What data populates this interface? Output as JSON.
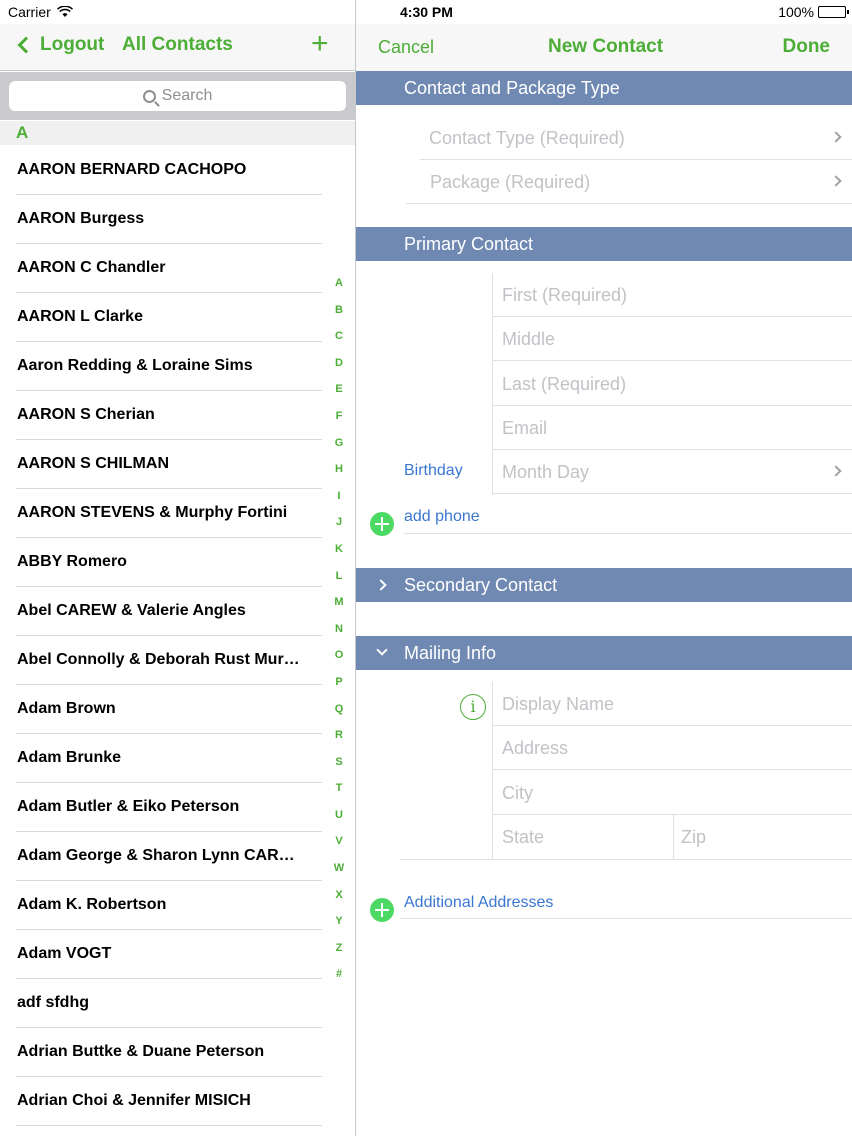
{
  "status": {
    "carrier": "Carrier",
    "time": "4:30 PM",
    "battery": "100%"
  },
  "left_nav": {
    "back_label": "Logout",
    "title": "All Contacts",
    "add_label": "+"
  },
  "search": {
    "placeholder": "Search"
  },
  "section_letter": "A",
  "contacts": [
    "AARON BERNARD CACHOPO",
    "AARON Burgess",
    "AARON C Chandler",
    "AARON L Clarke",
    "Aaron Redding & Loraine Sims",
    "AARON S Cherian",
    "AARON S CHILMAN",
    "AARON STEVENS & Murphy Fortini",
    "ABBY Romero",
    "Abel CAREW & Valerie Angles",
    "Abel Connolly & Deborah Rust Mur…",
    "Adam Brown",
    "Adam Brunke",
    "Adam Butler & Eiko Peterson",
    "Adam George & Sharon Lynn CAR…",
    "Adam K. Robertson",
    "Adam VOGT",
    "adf sfdhg",
    "Adrian Buttke & Duane Peterson",
    "Adrian Choi & Jennifer MISICH"
  ],
  "index": [
    "A",
    "B",
    "C",
    "D",
    "E",
    "F",
    "G",
    "H",
    "I",
    "J",
    "K",
    "L",
    "M",
    "N",
    "O",
    "P",
    "Q",
    "R",
    "S",
    "T",
    "U",
    "V",
    "W",
    "X",
    "Y",
    "Z",
    "#"
  ],
  "right_nav": {
    "cancel": "Cancel",
    "title": "New Contact",
    "done": "Done"
  },
  "form": {
    "section_type": "Contact and Package Type",
    "contact_type": "Contact Type (Required)",
    "package": "Package (Required)",
    "section_primary": "Primary Contact",
    "first": "First (Required)",
    "middle": "Middle",
    "last": "Last (Required)",
    "email": "Email",
    "birthday_label": "Birthday",
    "birthday_placeholder": "Month Day",
    "add_phone": "add phone",
    "section_secondary": "Secondary Contact",
    "section_mailing": "Mailing Info",
    "display_name": "Display Name",
    "address": "Address",
    "city": "City",
    "state": "State",
    "zip": "Zip",
    "additional_addresses": "Additional Addresses"
  },
  "colors": {
    "accent": "#4cae36",
    "section_header": "#7089b2",
    "link": "#3a77d1"
  }
}
